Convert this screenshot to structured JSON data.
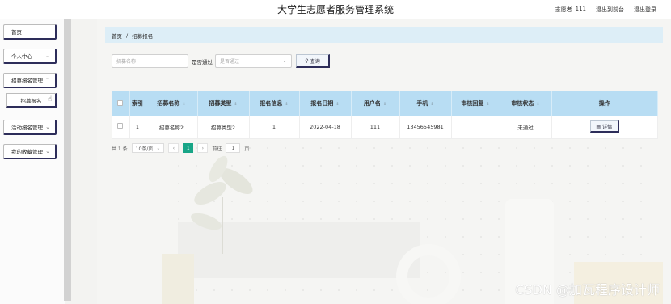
{
  "header": {
    "title": "大学生志愿者服务管理系统",
    "user_role": "志愿者",
    "username": "111",
    "back_to_admin": "退出到前台",
    "logout": "退出登录"
  },
  "sidebar": {
    "items": [
      {
        "label": "首页"
      },
      {
        "label": "个人中心"
      },
      {
        "label": "招募报名管理"
      },
      {
        "label": "招募报名"
      },
      {
        "label": "活动报名管理"
      },
      {
        "label": "我的收藏管理"
      }
    ]
  },
  "breadcrumb": {
    "home": "首页",
    "separator": "/",
    "current": "招募报名"
  },
  "search": {
    "name_placeholder": "招募名称",
    "status_label": "是否通过",
    "status_placeholder": "是否通过",
    "query_label": "查询",
    "query_icon": "search-icon"
  },
  "table": {
    "headers": [
      "索引",
      "招募名称",
      "招募类型",
      "报名信息",
      "报名日期",
      "用户名",
      "手机",
      "审核回复",
      "审核状态",
      "操作"
    ],
    "rows": [
      {
        "index": "1",
        "recruit_name": "招募名称2",
        "recruit_type": "招募类型2",
        "signup_info": "1",
        "signup_date": "2022-04-18",
        "username": "111",
        "phone": "13456545981",
        "reply": "",
        "status": "未通过",
        "action": "详情"
      }
    ]
  },
  "pagination": {
    "total_prefix": "共 1 条",
    "page_size": "10条/页",
    "current_page": "1",
    "goto_label": "前往",
    "goto_value": "1",
    "goto_suffix": "页"
  },
  "watermark": "CSDN @加瓦程序设计师",
  "colors": {
    "header_bg": "#b8ddf3",
    "breadcrumb_bg": "#ddeef7",
    "active_page": "#18a587",
    "button_border": "#2d2d5a"
  }
}
